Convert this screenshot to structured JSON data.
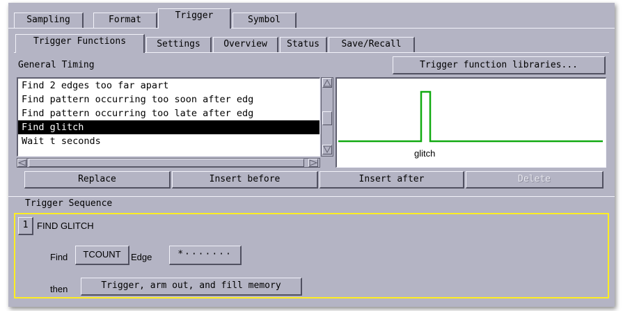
{
  "tabs": [
    "Sampling",
    "Format",
    "Trigger",
    "Symbol"
  ],
  "subtabs": [
    "Trigger Functions",
    "Settings",
    "Overview",
    "Status",
    "Save/Recall"
  ],
  "general_timing_label": "General Timing",
  "libraries_button": "Trigger function libraries...",
  "functions": [
    "Find 2 edges too far apart",
    "Find pattern occurring too soon after edg",
    "Find pattern occurring too late after edg",
    "Find glitch",
    "Wait t seconds"
  ],
  "selected_function": "Find glitch",
  "waveform_label": "glitch",
  "actions": {
    "replace": "Replace",
    "insert_before": "Insert before",
    "insert_after": "Insert after",
    "delete": "Delete"
  },
  "sequence": {
    "title": "Trigger Sequence",
    "step_number": "1",
    "step_name": "FIND GLITCH",
    "find_label": "Find",
    "find_value": "TCOUNT",
    "edge_label": "Edge",
    "edge_value": "*·······",
    "then_label": "then",
    "then_value": "Trigger, arm out, and fill memory"
  },
  "colors": {
    "panel": "#b4b4c4",
    "waveform": "#11aa11",
    "sequence_border": "#ffee22",
    "selection_bg": "#000000"
  }
}
